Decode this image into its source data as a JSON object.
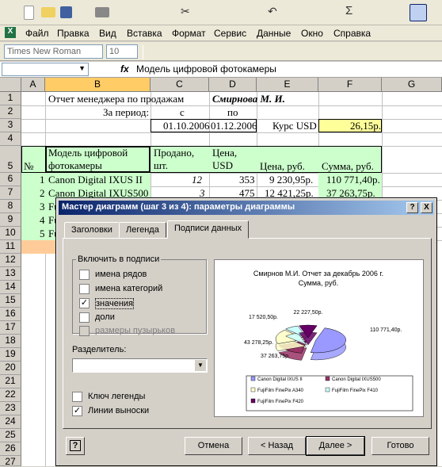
{
  "menu": [
    "Файл",
    "Правка",
    "Вид",
    "Вставка",
    "Формат",
    "Сервис",
    "Данные",
    "Окно",
    "Справка"
  ],
  "font_name": "Times New Roman",
  "font_size": "10",
  "formula": {
    "cell_ref": "",
    "fx": "fx",
    "value": "Модель цифровой фотокамеры"
  },
  "columns": [
    "A",
    "B",
    "C",
    "D",
    "E",
    "F",
    "G"
  ],
  "rows": [
    "1",
    "2",
    "3",
    "4",
    "5",
    "6",
    "7",
    "8",
    "9",
    "10",
    "11",
    "12",
    "13",
    "14",
    "15",
    "16",
    "17",
    "18",
    "19",
    "20",
    "21",
    "22",
    "23",
    "24",
    "25",
    "26",
    "27"
  ],
  "sheet": {
    "b1": "Отчет менеджера по продажам",
    "d1": "Смирнова М. И.",
    "b2": "За период:",
    "c2": "с",
    "d2": "по",
    "c3": "01.10.2006",
    "d3": "01.12.2006",
    "e3": "Курс USD",
    "f3": "26,15р.",
    "a5": "№",
    "b5a": "Модель цифровой",
    "b5b": "фотокамеры",
    "c5a": "Продано,",
    "c5b": "шт.",
    "d5a": "Цена,",
    "d5b": "USD",
    "e5": "Цена, руб.",
    "f5": "Сумма, руб.",
    "a6": "1",
    "b6": "Canon Digital IXUS II",
    "c6": "12",
    "d6": "353",
    "e6": "9 230,95р.",
    "f6": "110 771,40р.",
    "a7": "2",
    "b7": "Canon Digital IXUS500",
    "c7": "3",
    "d7": "475",
    "e7": "12 421,25р.",
    "f7": "37 263,75р.",
    "a8": "3",
    "b8": "Fu",
    "a9": "4",
    "b9": "Fu",
    "a10": "5",
    "b10": "Fu"
  },
  "dialog": {
    "title": "Мастер диаграмм (шаг 3 из 4): параметры диаграммы",
    "help_btn": "?",
    "close_btn": "X",
    "tabs": [
      "Заголовки",
      "Легенда",
      "Подписи данных"
    ],
    "group_label": "Включить в подписи",
    "checks": [
      {
        "label": "имена рядов",
        "checked": false
      },
      {
        "label": "имена категорий",
        "checked": false
      },
      {
        "label": "значения",
        "checked": true
      },
      {
        "label": "доли",
        "checked": false
      },
      {
        "label": "размеры пузырьков",
        "checked": false
      }
    ],
    "separator_label": "Разделитель:",
    "legend_key": "Ключ легенды",
    "leader_lines": "Линии выноски",
    "buttons": [
      "Отмена",
      "< Назад",
      "Далее >",
      "Готово"
    ]
  },
  "chart_data": {
    "type": "pie",
    "title": "Смирнов М.И. Отчет за декабрь 2006 г.",
    "subtitle": "Сумма, руб.",
    "labels": [
      "110 771,40р.",
      "37 263,75р.",
      "43 278,25р.",
      "17 520,50р.",
      "22 227,50р."
    ],
    "categories": [
      "Canon Digital IXUS II",
      "Canon Digital IXUS500",
      "FujiFilm FinePix A340",
      "FujiFilm FinePix F410",
      "FujiFilm FinePix F420"
    ],
    "values": [
      110771.4,
      37263.75,
      43278.25,
      17520.5,
      22227.5
    ],
    "colors": [
      "#9999ff",
      "#993366",
      "#ffffcc",
      "#ccffff",
      "#660066"
    ]
  }
}
